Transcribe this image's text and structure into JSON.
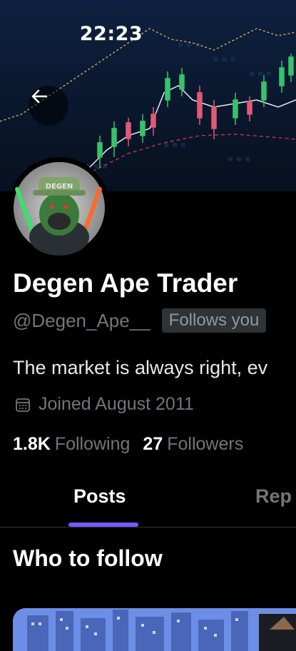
{
  "status_bar": {
    "time": "22:23"
  },
  "profile": {
    "name": "Degen Ape Trader",
    "handle": "@Degen_Ape__",
    "follows_you": "Follows you",
    "bio": "The market is always right, ev",
    "joined": "Joined August 2011",
    "avatar_hat_text": "DEGEN",
    "following_count": "1.8K",
    "following_label": "Following",
    "followers_count": "27",
    "followers_label": "Followers"
  },
  "tabs": [
    {
      "label": "Posts",
      "active": true
    },
    {
      "label": "Rep",
      "active": false
    }
  ],
  "who_to_follow": {
    "title": "Who to follow"
  },
  "colors": {
    "accent": "#7856ff",
    "muted": "#71767b",
    "banner": "#0a1628"
  }
}
